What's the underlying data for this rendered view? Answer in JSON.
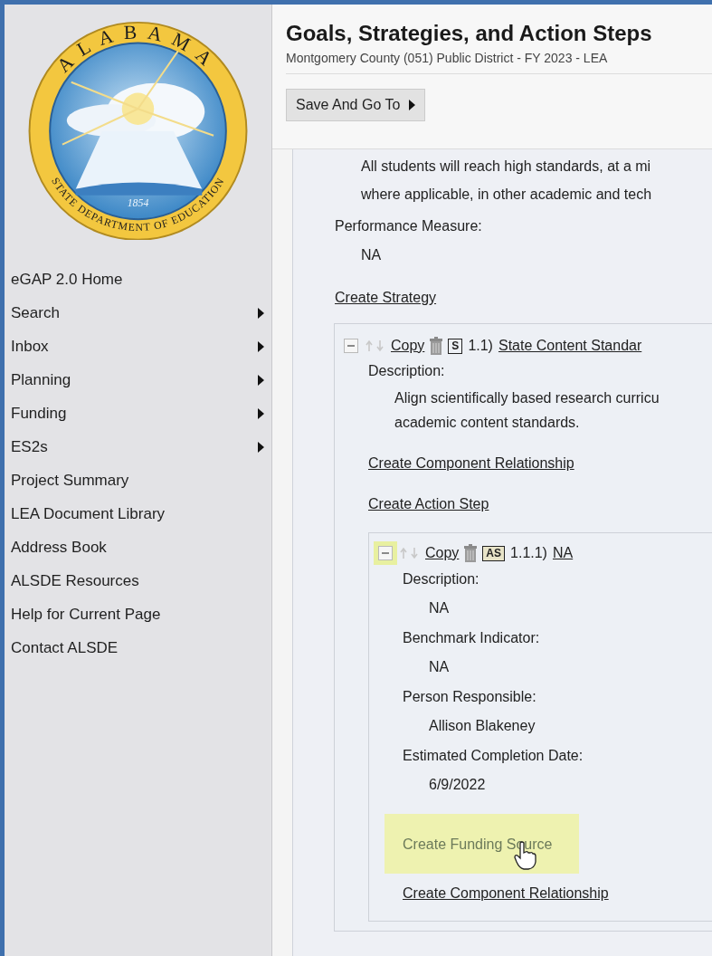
{
  "logo": {
    "top_text": "ALABAMA",
    "bottom_text": "STATE DEPARTMENT OF EDUCATION",
    "year": "1854"
  },
  "nav": [
    {
      "label": "eGAP 2.0 Home",
      "submenu": false
    },
    {
      "label": "Search",
      "submenu": true
    },
    {
      "label": "Inbox",
      "submenu": true
    },
    {
      "label": "Planning",
      "submenu": true
    },
    {
      "label": "Funding",
      "submenu": true
    },
    {
      "label": "ES2s",
      "submenu": true
    },
    {
      "label": "Project Summary",
      "submenu": false
    },
    {
      "label": "LEA Document Library",
      "submenu": false
    },
    {
      "label": "Address Book",
      "submenu": false
    },
    {
      "label": "ALSDE Resources",
      "submenu": false
    },
    {
      "label": "Help for Current Page",
      "submenu": false
    },
    {
      "label": "Contact ALSDE",
      "submenu": false
    }
  ],
  "header": {
    "title": "Goals, Strategies, and Action Steps",
    "subtitle": "Montgomery County (051) Public District - FY 2023 - LEA",
    "save_button": "Save And Go To"
  },
  "goal": {
    "description_lines": [
      "All students will reach high standards, at a mi",
      "where applicable, in other academic and tech"
    ],
    "performance_label": "Performance Measure:",
    "performance_value": "NA",
    "create_link": "Create Strategy"
  },
  "strategy": {
    "expanded": true,
    "copy": "Copy",
    "badge": "S",
    "number": "1.1)",
    "title": "State Content Standar",
    "description_label": "Description:",
    "description_lines": [
      "Align scientifically based research curricu",
      "academic content standards."
    ],
    "links": [
      "Create Component Relationship",
      "Create Action Step"
    ],
    "action_step": {
      "expanded": true,
      "highlighted": true,
      "copy": "Copy",
      "badge": "AS",
      "number": "1.1.1)",
      "title": "NA",
      "fields": [
        {
          "label": "Description:",
          "value": "NA"
        },
        {
          "label": "Benchmark Indicator:",
          "value": "NA"
        },
        {
          "label": "Person Responsible:",
          "value": "Allison Blakeney"
        },
        {
          "label": "Estimated Completion Date:",
          "value": "6/9/2022"
        }
      ],
      "links": [
        {
          "label": "Create Funding Source",
          "highlighted": true
        },
        {
          "label": "Create Component Relationship",
          "highlighted": false
        }
      ]
    }
  }
}
